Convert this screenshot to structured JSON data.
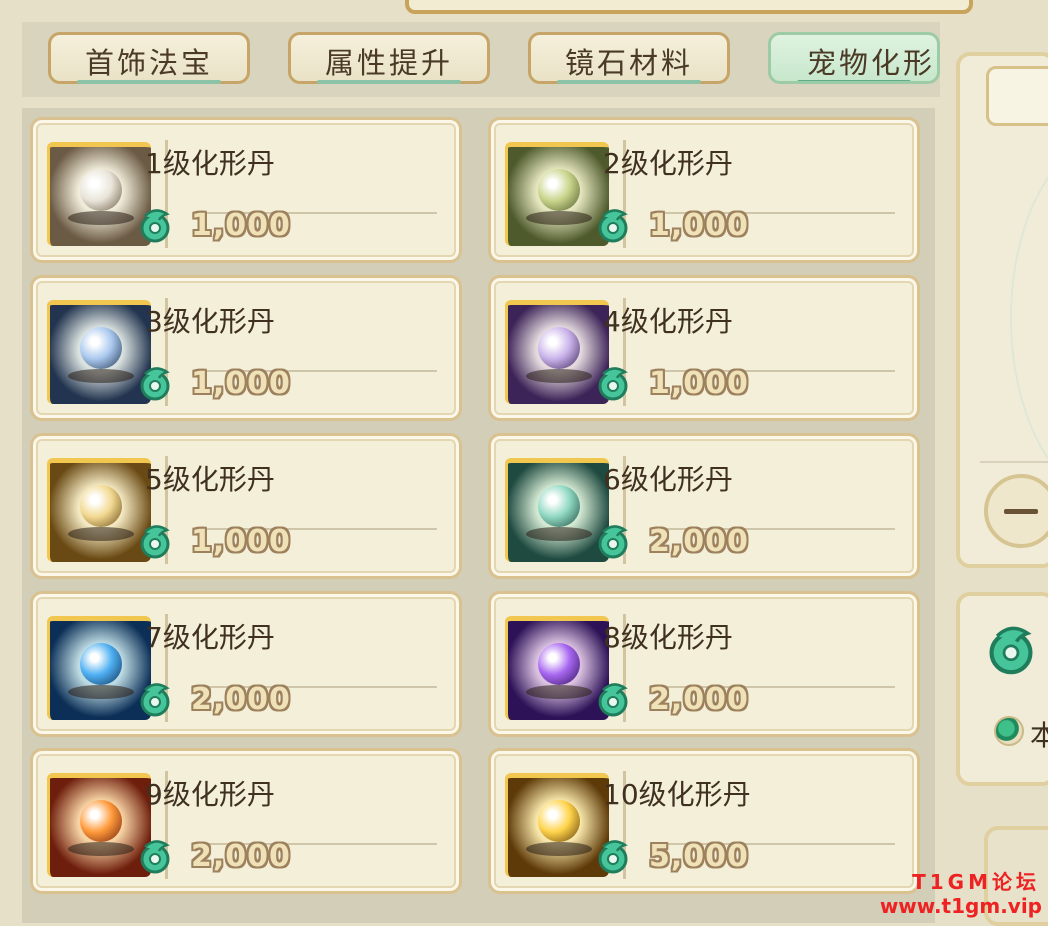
{
  "tabs": [
    {
      "label": "首饰法宝",
      "active": false
    },
    {
      "label": "属性提升",
      "active": false
    },
    {
      "label": "镜石材料",
      "active": false
    },
    {
      "label": "宠物化形",
      "active": true
    }
  ],
  "items": [
    {
      "name": "1级化形丹",
      "price": "1,000",
      "icon": "white-orb-icon",
      "orb_color": "#e8e4d8",
      "bg": "#6b5a44"
    },
    {
      "name": "2级化形丹",
      "price": "1,000",
      "icon": "green-orb-icon",
      "orb_color": "#c9d48a",
      "bg": "#4e5a2c"
    },
    {
      "name": "3级化形丹",
      "price": "1,000",
      "icon": "blue-orb-icon",
      "orb_color": "#a9c8ee",
      "bg": "#22344f"
    },
    {
      "name": "4级化形丹",
      "price": "1,000",
      "icon": "purple-orb-icon",
      "orb_color": "#c9b3ea",
      "bg": "#3d2458"
    },
    {
      "name": "5级化形丹",
      "price": "1,000",
      "icon": "gold-orb-icon",
      "orb_color": "#f2d991",
      "bg": "#6a4a14"
    },
    {
      "name": "6级化形丹",
      "price": "2,000",
      "icon": "jade-orb-icon",
      "orb_color": "#8fd8c1",
      "bg": "#1f4a40"
    },
    {
      "name": "7级化形丹",
      "price": "2,000",
      "icon": "azure-dragon-orb-icon",
      "orb_color": "#4fb0f2",
      "bg": "#0c2f57"
    },
    {
      "name": "8级化形丹",
      "price": "2,000",
      "icon": "violet-dragon-orb-icon",
      "orb_color": "#a866f0",
      "bg": "#2d1257"
    },
    {
      "name": "9级化形丹",
      "price": "2,000",
      "icon": "phoenix-orb-icon",
      "orb_color": "#ff9a3a",
      "bg": "#6e1e0c"
    },
    {
      "name": "10级化形丹",
      "price": "5,000",
      "icon": "golden-dragon-orb-icon",
      "orb_color": "#ffd34a",
      "bg": "#5e3a08"
    }
  ],
  "currency_icon": "jade-dragon-coin-icon",
  "side_panel": {
    "radio_label": "本"
  },
  "watermark": {
    "line1": "T1GM论坛",
    "line2": "www.t1gm.vip"
  }
}
